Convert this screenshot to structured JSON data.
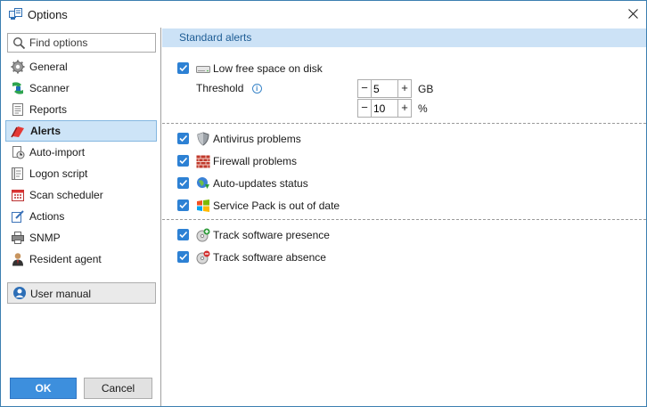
{
  "window": {
    "title": "Options"
  },
  "search": {
    "placeholder": "Find options"
  },
  "sidebar": {
    "items": [
      {
        "label": "General"
      },
      {
        "label": "Scanner"
      },
      {
        "label": "Reports"
      },
      {
        "label": "Alerts",
        "selected": true
      },
      {
        "label": "Auto-import"
      },
      {
        "label": "Logon script"
      },
      {
        "label": "Scan scheduler"
      },
      {
        "label": "Actions"
      },
      {
        "label": "SNMP"
      },
      {
        "label": "Resident agent"
      }
    ],
    "user_manual": "User manual"
  },
  "buttons": {
    "ok": "OK",
    "cancel": "Cancel"
  },
  "content": {
    "section_title": "Standard alerts",
    "low_disk": {
      "label": "Low free space on disk",
      "checked": true
    },
    "threshold": {
      "label": "Threshold",
      "gb_value": "5",
      "gb_unit": "GB",
      "pct_value": "10",
      "pct_unit": "%"
    },
    "group2": [
      {
        "label": "Antivirus problems",
        "checked": true
      },
      {
        "label": "Firewall problems",
        "checked": true
      },
      {
        "label": "Auto-updates status",
        "checked": true
      },
      {
        "label": "Service Pack is out of date",
        "checked": true
      }
    ],
    "group3": [
      {
        "label": "Track software presence",
        "checked": true
      },
      {
        "label": "Track software absence",
        "checked": true
      }
    ]
  },
  "colors": {
    "accent": "#2d81d4",
    "header_bg": "#cce2f6",
    "selected_bg": "#cde4f7",
    "ok_button": "#3d8fdd"
  }
}
